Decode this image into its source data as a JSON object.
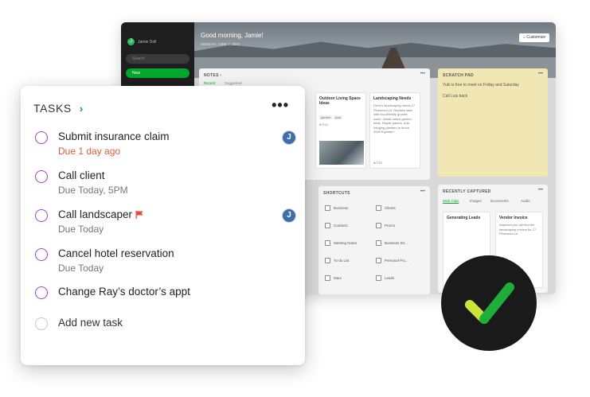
{
  "app": {
    "user_name": "Jamie Doll",
    "user_initial": "J",
    "search_label": "Search",
    "new_label": "New",
    "greeting": "Good morning, Jamie!",
    "date": "MONDAY, JUNE 7, 2021",
    "customize_label": "Customize",
    "notes": {
      "title": "NOTES",
      "tabs": [
        "Recent",
        "Suggested"
      ],
      "cards": [
        {
          "title": "Outdoor Living Space Ideas",
          "tags": [
            "garden",
            "pool"
          ],
          "date": "6/7/21"
        },
        {
          "title": "Landscaping Needs",
          "body": "Drew's landscaping needs 17 Pinewood Ln. Replace lawn with eco-friendly ground cover. Install raised garden beds. Repair pavers. Add hanging planters to fence. 30x8 ft garden.",
          "date": "6/7/21"
        }
      ]
    },
    "scratch_pad": {
      "title": "SCRATCH PAD",
      "lines": [
        "Yuki is free to meet on Friday and Saturday",
        "Call Luis back"
      ]
    },
    "shortcuts": {
      "title": "SHORTCUTS",
      "items": [
        "Business",
        "Clients",
        "Contacts",
        "Promo",
        "Meeting Notes",
        "Business Str...",
        "To-do List",
        "Personal Pro...",
        "Maui",
        "Leads"
      ]
    },
    "recently_captured": {
      "title": "RECENTLY CAPTURED",
      "tabs": [
        "Web Clips",
        "Images",
        "Documents",
        "Audio"
      ],
      "cards": [
        {
          "title": "Generating Leads"
        },
        {
          "title": "Vendor Invoice",
          "body": "Attached you will find the landscaping invoice for 17 Pinewood Ln."
        }
      ]
    }
  },
  "tasks": {
    "title": "TASKS",
    "items": [
      {
        "title": "Submit insurance claim",
        "due": "Due 1 day ago",
        "overdue": true,
        "assignee": "J",
        "flagged": false
      },
      {
        "title": "Call client",
        "due": "Due Today, 5PM",
        "overdue": false,
        "assignee": null,
        "flagged": false
      },
      {
        "title": "Call landscaper",
        "due": "Due Today",
        "overdue": false,
        "assignee": "J",
        "flagged": true
      },
      {
        "title": "Cancel hotel reservation",
        "due": "Due Today",
        "overdue": false,
        "assignee": null,
        "flagged": false
      },
      {
        "title": "Change Ray’s doctor’s appt",
        "due": "",
        "overdue": false,
        "assignee": null,
        "flagged": false
      }
    ],
    "add_label": "Add new task"
  },
  "colors": {
    "accent_green": "#00a82d",
    "checkbox_purple": "#a63fc6",
    "overdue_red": "#e55a43",
    "flag_red": "#e8483b",
    "badge_dark": "#1a1a1a",
    "check_green": "#1fae3a",
    "check_lime": "#cde23a"
  },
  "icons": {
    "header_chevron": "chevron-right-icon",
    "more": "more-horizontal-icon",
    "flag": "flag-icon",
    "check_badge": "checkmark-icon"
  }
}
